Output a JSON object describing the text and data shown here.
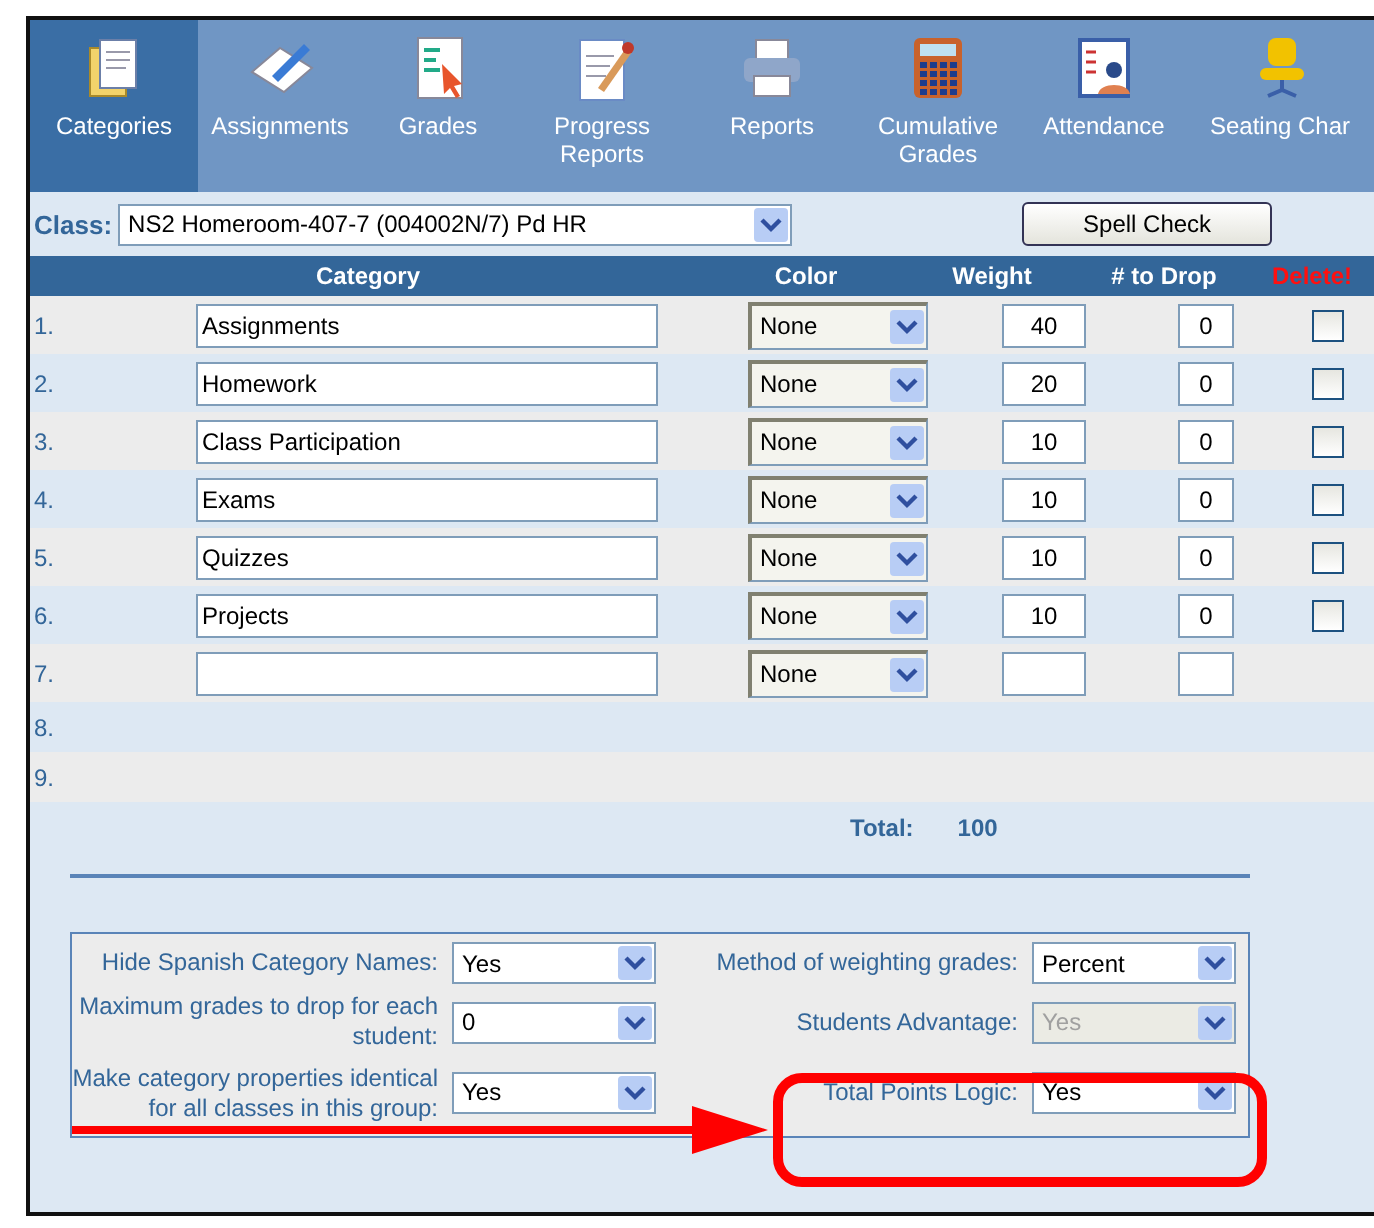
{
  "toolbar": {
    "tabs": [
      {
        "label": "Categories",
        "selected": true
      },
      {
        "label": "Assignments",
        "selected": false
      },
      {
        "label": "Grades",
        "selected": false
      },
      {
        "label": "Progress Reports",
        "selected": false
      },
      {
        "label": "Reports",
        "selected": false
      },
      {
        "label": "Cumulative Grades",
        "selected": false
      },
      {
        "label": "Attendance",
        "selected": false
      },
      {
        "label": "Seating Char",
        "selected": false
      }
    ]
  },
  "class_bar": {
    "label": "Class:",
    "value": "NS2 Homeroom-407-7 (004002N/7) Pd HR",
    "button": "Spell Check"
  },
  "table": {
    "columns": [
      "Category",
      "Color",
      "Weight",
      "# to Drop",
      "Delete!"
    ],
    "rows": [
      {
        "kind": "entry",
        "number": "1.",
        "category": "Assignments",
        "color_choice": "None",
        "weight": "40",
        "drop": "0",
        "delete": false
      },
      {
        "kind": "entry",
        "number": "2.",
        "category": "Homework",
        "color_choice": "None",
        "weight": "20",
        "drop": "0",
        "delete": false
      },
      {
        "kind": "entry",
        "number": "3.",
        "category": "Class Participation",
        "color_choice": "None",
        "weight": "10",
        "drop": "0",
        "delete": false
      },
      {
        "kind": "entry",
        "number": "4.",
        "category": "Exams",
        "color_choice": "None",
        "weight": "10",
        "drop": "0",
        "delete": false
      },
      {
        "kind": "entry",
        "number": "5.",
        "category": "Quizzes",
        "color_choice": "None",
        "weight": "10",
        "drop": "0",
        "delete": false
      },
      {
        "kind": "entry",
        "number": "6.",
        "category": "Projects",
        "color_choice": "None",
        "weight": "10",
        "drop": "0",
        "delete": false
      },
      {
        "kind": "new",
        "number": "7.",
        "color_choice": "None"
      },
      {
        "kind": "blank",
        "number": "8."
      },
      {
        "kind": "blank",
        "number": "9."
      }
    ],
    "total": {
      "label": "Total:",
      "value": "100"
    }
  },
  "options": {
    "left": [
      {
        "label": "Hide Spanish Category Names:",
        "value": "Yes",
        "disabled": false
      },
      {
        "label": "Maximum grades to drop for each student:",
        "value": "0",
        "disabled": false
      },
      {
        "label": "Make category properties identical for all classes in this group:",
        "value": "Yes",
        "disabled": false
      }
    ],
    "right": [
      {
        "label": "Method of weighting grades:",
        "value": "Percent",
        "disabled": false
      },
      {
        "label": "Students Advantage:",
        "value": "Yes",
        "disabled": true
      },
      {
        "label": "Total Points Logic:",
        "value": "Yes",
        "disabled": false
      }
    ]
  }
}
